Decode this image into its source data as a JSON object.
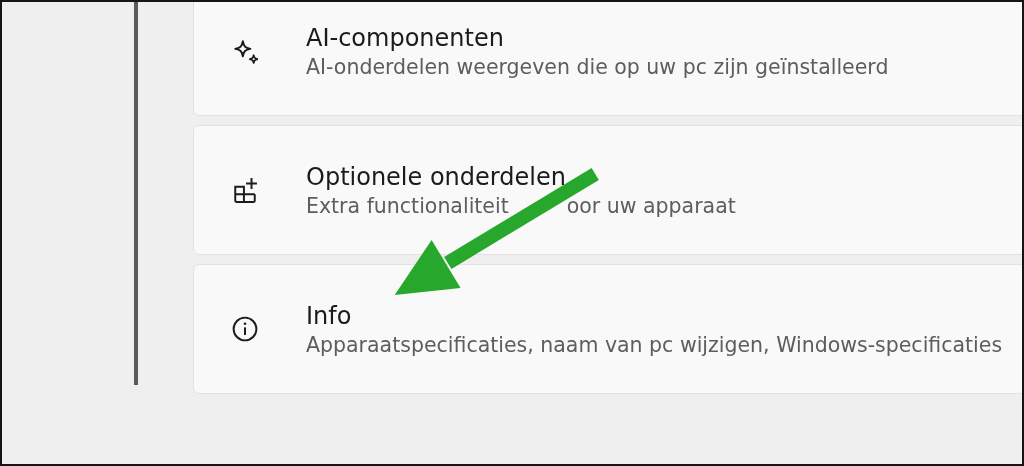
{
  "settings_items": [
    {
      "title": "AI-componenten",
      "description": [
        "AI-onderdelen weergeven die op uw pc zijn geïnstalleerd"
      ]
    },
    {
      "title": "Optionele onderdelen",
      "description": [
        "Extra functionaliteit",
        "oor uw apparaat"
      ]
    },
    {
      "title": "Info",
      "description": [
        "Apparaatspecificaties, naam van pc wijzigen, Windows-specificaties"
      ]
    }
  ]
}
